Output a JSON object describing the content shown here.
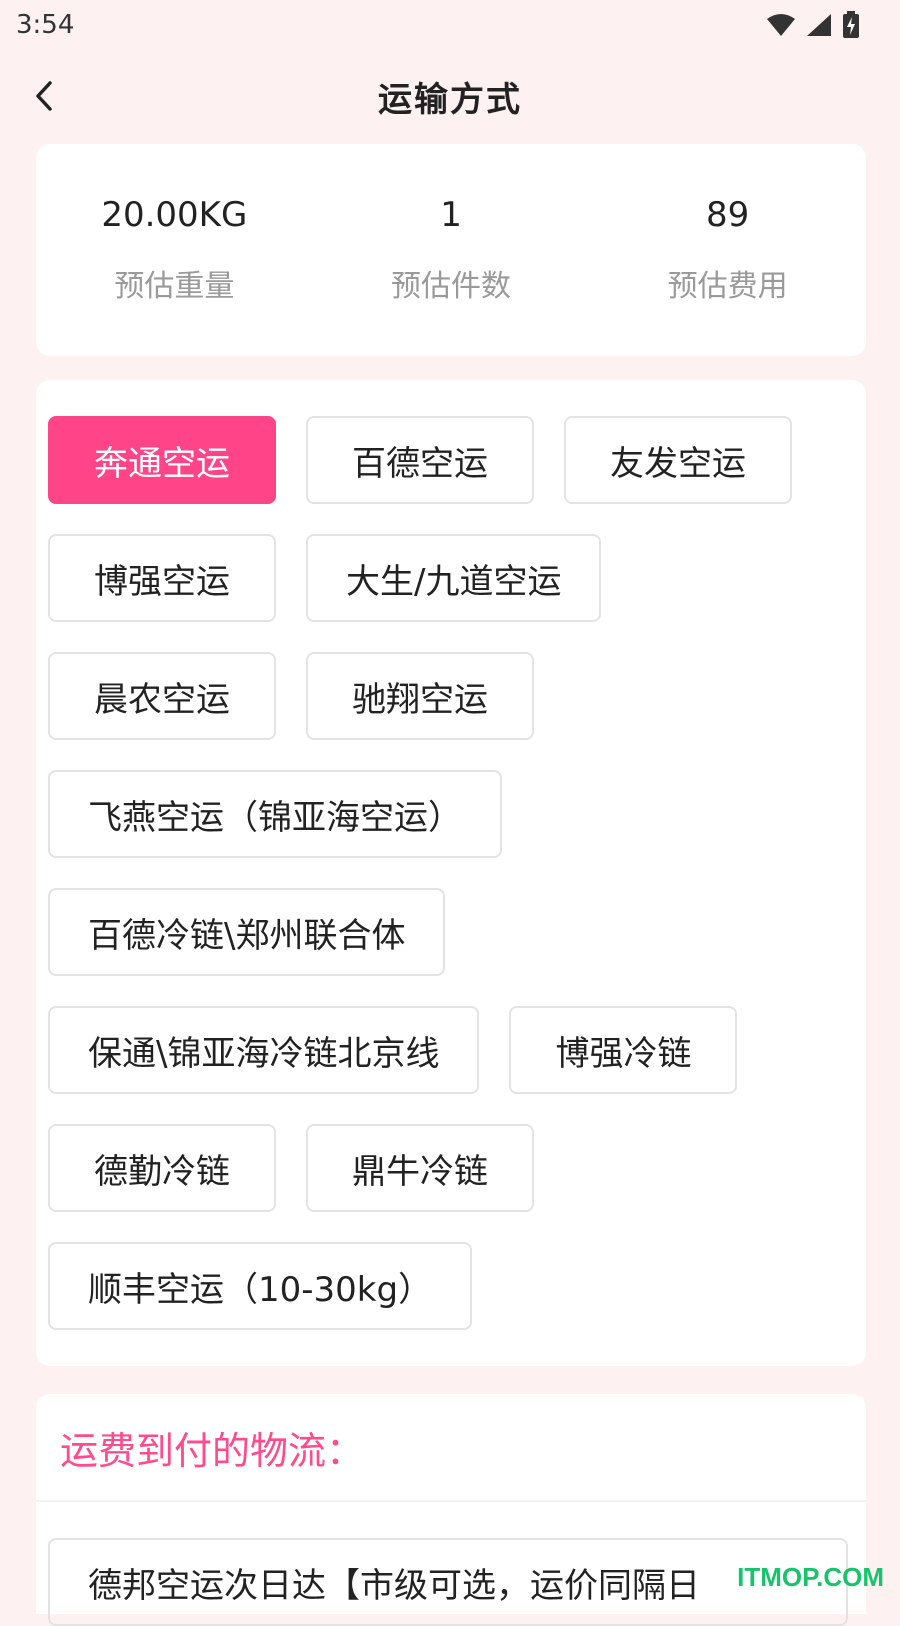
{
  "status_bar": {
    "time": "3:54",
    "icons": [
      "wifi-icon",
      "signal-icon",
      "battery-icon"
    ]
  },
  "header": {
    "title": "运输方式",
    "back_icon": "chevron-left-icon"
  },
  "summary": {
    "weight": {
      "value": "20.00KG",
      "label": "预估重量"
    },
    "count": {
      "value": "1",
      "label": "预估件数"
    },
    "fee": {
      "value": "89",
      "label": "预估费用"
    }
  },
  "transport_options": {
    "selected": "奔通空运",
    "rows": [
      [
        "奔通空运",
        "百德空运",
        "友发空运"
      ],
      [
        "博强空运",
        "大生/九道空运"
      ],
      [
        "晨农空运",
        "驰翔空运"
      ],
      [
        "飞燕空运（锦亚海空运）"
      ],
      [
        "百德冷链\\郑州联合体"
      ],
      [
        "保通\\锦亚海冷链北京线",
        "博强冷链"
      ],
      [
        "德勤冷链",
        "鼎牛冷链"
      ],
      [
        "顺丰空运（10-30kg）"
      ]
    ]
  },
  "collect_on_delivery": {
    "title": "运费到付的物流：",
    "first_item": "德邦空运次日达【市级可选，运价同隔日"
  },
  "watermark": "ITMOP.COM",
  "colors": {
    "accent": "#ff4487",
    "background": "#fdf1f2",
    "title_pink": "#ff4a8e"
  }
}
